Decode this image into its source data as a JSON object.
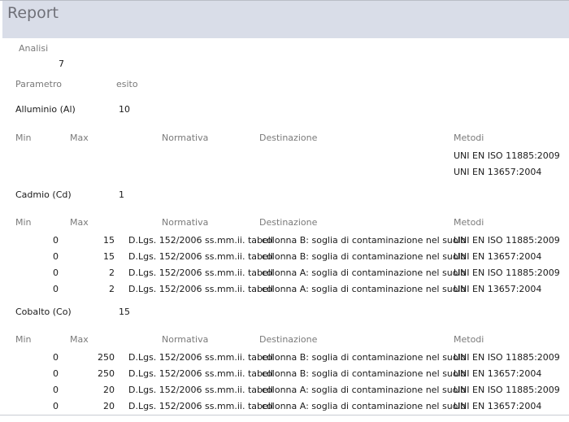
{
  "report": {
    "title": "Report",
    "analisi_label": "Analisi",
    "analisi_value": "7",
    "parametro_label": "Parametro",
    "esito_label": "esito"
  },
  "columns": {
    "min": "Min",
    "max": "Max",
    "normativa": "Normativa",
    "destinazione": "Destinazione",
    "metodi": "Metodi"
  },
  "groups": [
    {
      "parametro": "Alluminio (Al)",
      "esito": "10",
      "rows": [
        {
          "min": "",
          "max": "",
          "normativa": "",
          "destinazione": "",
          "metodo": "UNI EN ISO 11885:2009"
        },
        {
          "min": "",
          "max": "",
          "normativa": "",
          "destinazione": "",
          "metodo": "UNI EN 13657:2004"
        }
      ]
    },
    {
      "parametro": "Cadmio (Cd)",
      "esito": "1",
      "rows": [
        {
          "min": "0",
          "max": "15",
          "normativa": "D.Lgs. 152/2006 ss.mm.ii. tabell",
          "destinazione": "colonna B: soglia di contaminazione nel suolo",
          "metodo": "UNI EN ISO 11885:2009"
        },
        {
          "min": "0",
          "max": "15",
          "normativa": "D.Lgs. 152/2006 ss.mm.ii. tabell",
          "destinazione": "colonna B: soglia di contaminazione nel suolo",
          "metodo": "UNI EN 13657:2004"
        },
        {
          "min": "0",
          "max": "2",
          "normativa": "D.Lgs. 152/2006 ss.mm.ii. tabell",
          "destinazione": "colonna A: soglia di contaminazione nel suolo",
          "metodo": "UNI EN ISO 11885:2009"
        },
        {
          "min": "0",
          "max": "2",
          "normativa": "D.Lgs. 152/2006 ss.mm.ii. tabell",
          "destinazione": "colonna A: soglia di contaminazione nel suolo",
          "metodo": "UNI EN 13657:2004"
        }
      ]
    },
    {
      "parametro": "Cobalto (Co)",
      "esito": "15",
      "rows": [
        {
          "min": "0",
          "max": "250",
          "normativa": "D.Lgs. 152/2006 ss.mm.ii. tabell",
          "destinazione": "colonna B: soglia di contaminazione nel suolo",
          "metodo": "UNI EN ISO 11885:2009"
        },
        {
          "min": "0",
          "max": "250",
          "normativa": "D.Lgs. 152/2006 ss.mm.ii. tabell",
          "destinazione": "colonna B: soglia di contaminazione nel suolo",
          "metodo": "UNI EN 13657:2004"
        },
        {
          "min": "0",
          "max": "20",
          "normativa": "D.Lgs. 152/2006 ss.mm.ii. tabell",
          "destinazione": "colonna A: soglia di contaminazione nel suolo",
          "metodo": "UNI EN ISO 11885:2009"
        },
        {
          "min": "0",
          "max": "20",
          "normativa": "D.Lgs. 152/2006 ss.mm.ii. tabell",
          "destinazione": "colonna A: soglia di contaminazione nel suolo",
          "metodo": "UNI EN 13657:2004"
        }
      ]
    }
  ]
}
